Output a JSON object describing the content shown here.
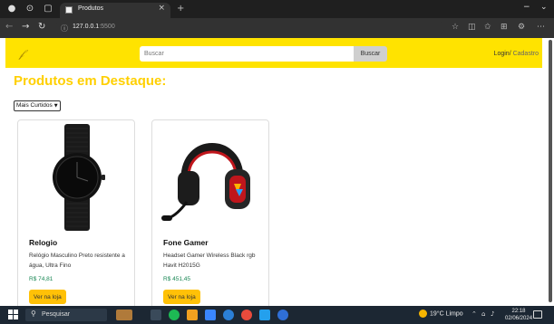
{
  "browser": {
    "tab_title": "Produtos",
    "tab_close": "×",
    "new_tab": "+",
    "url_host": "127.0.0.1",
    "url_port": ":5500",
    "window_controls": [
      "−",
      "⌄"
    ],
    "icons": [
      "profile-icon",
      "workspaces-icon",
      "tab-actions-icon",
      "back-icon",
      "forward-icon",
      "reload-icon",
      "info-icon",
      "favorite-icon",
      "split-screen-icon",
      "favorites-icon",
      "collections-icon",
      "extensions-icon",
      "more-icon"
    ]
  },
  "navbar": {
    "search_placeholder": "Buscar",
    "search_button": "Buscar",
    "login": "Login",
    "separator": "/",
    "register": "Cadastro"
  },
  "page": {
    "title": "Produtos em Destaque:",
    "sort_selected": "Mais Curtidos"
  },
  "products": [
    {
      "name": "Relogio",
      "description": "Relógio Masculino Preto resistente a água, Ultra Fino",
      "price": "R$ 74,81",
      "button": "Ver na loja"
    },
    {
      "name": "Fone Gamer",
      "description": "Headset Gamer Wireless Black rgb Havit H2015G",
      "price": "R$ 451,45",
      "button": "Ver na loja"
    }
  ],
  "taskbar": {
    "search_label": "Pesquisar",
    "weather": "19°C  Limpo",
    "time": "22:18",
    "date": "02/06/2024"
  },
  "colors": {
    "navbar_bg": "#ffe300",
    "title": "#ffd000",
    "price": "#198754",
    "button": "#ffc107"
  }
}
